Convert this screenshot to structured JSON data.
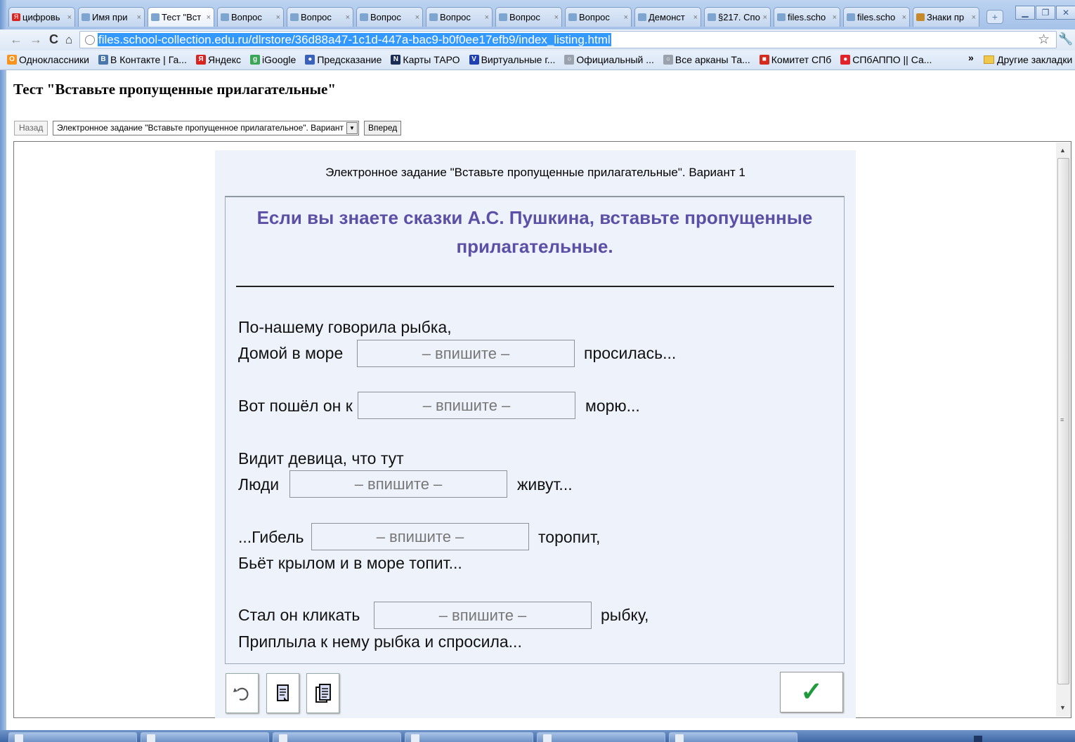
{
  "browser": {
    "tabs": [
      {
        "label": "цифровь",
        "icon": "yandex-icon"
      },
      {
        "label": "Имя при",
        "icon": "school-collection-icon"
      },
      {
        "label": "Тест \"Вст",
        "icon": "school-collection-icon",
        "active": true
      },
      {
        "label": "Вопрос",
        "icon": "school-collection-icon"
      },
      {
        "label": "Вопрос",
        "icon": "school-collection-icon"
      },
      {
        "label": "Вопрос",
        "icon": "school-collection-icon"
      },
      {
        "label": "Вопрос",
        "icon": "school-collection-icon"
      },
      {
        "label": "Вопрос",
        "icon": "school-collection-icon"
      },
      {
        "label": "Вопрос",
        "icon": "school-collection-icon"
      },
      {
        "label": "Демонст",
        "icon": "school-collection-icon"
      },
      {
        "label": "§217. Спо",
        "icon": "school-collection-icon"
      },
      {
        "label": "files.scho",
        "icon": "school-collection-icon"
      },
      {
        "label": "files.scho",
        "icon": "school-collection-icon"
      },
      {
        "label": "Знаки пр",
        "icon": "page-icon"
      }
    ],
    "url": "files.school-collection.edu.ru/dlrstore/36d88a47-1c1d-447a-bac9-b0f0ee17efb9/index_listing.html",
    "bookmarks": [
      {
        "label": "Одноклассники",
        "icon": "odnoklassniki-icon",
        "color": "#f7931e",
        "glyph": "О"
      },
      {
        "label": "В Контакте | Га...",
        "icon": "vkontakte-icon",
        "color": "#4a76a8",
        "glyph": "В"
      },
      {
        "label": "Яндекс",
        "icon": "yandex-icon",
        "color": "#d8231f",
        "glyph": "Я"
      },
      {
        "label": "iGoogle",
        "icon": "igoogle-icon",
        "color": "#3aa657",
        "glyph": "g"
      },
      {
        "label": "Предсказание",
        "icon": "globe-icon",
        "color": "#3a62b8",
        "glyph": "●"
      },
      {
        "label": "Карты ТАРО",
        "icon": "n-icon",
        "color": "#1b2c55",
        "glyph": "N"
      },
      {
        "label": "Виртуальные г...",
        "icon": "v-icon",
        "color": "#2140b0",
        "glyph": "V"
      },
      {
        "label": "Официальный ...",
        "icon": "page-icon",
        "color": "#9aa3ad",
        "glyph": "○"
      },
      {
        "label": "Все арканы Та...",
        "icon": "page-icon",
        "color": "#9aa3ad",
        "glyph": "○"
      },
      {
        "label": "Комитет СПб",
        "icon": "flag-icon",
        "color": "#d52b1e",
        "glyph": "■"
      },
      {
        "label": "СПбАППО || Са...",
        "icon": "dot-icon",
        "color": "#e0242a",
        "glyph": "●"
      }
    ],
    "bookmarks_more": "»",
    "other_bookmarks": "Другие закладки"
  },
  "page": {
    "title": "Тест \"Вставьте пропущенные прилагательные\"",
    "back_label": "Назад",
    "variant_select": "Электронное задание \"Вставьте пропущенное прилагательное\". Вариант 1",
    "forward_label": "Вперед"
  },
  "task": {
    "header": "Электронное задание \"Вставьте пропущенные прилагательные\". Вариант 1",
    "question": "Если вы знаете сказки А.С. Пушкина, вставьте пропущенные прилагательные.",
    "placeholder": "– впишите –",
    "items": [
      {
        "pre_line": "По-нашему говорила рыбка,",
        "before": "Домой в море",
        "after": "просилась..."
      },
      {
        "before": "Вот пошёл он к",
        "after": "морю..."
      },
      {
        "pre_line": "Видит девица, что тут",
        "before": "Люди",
        "after": "живут..."
      },
      {
        "before": "...Гибель",
        "after": "торопит,",
        "post_line": "Бьёт крылом и в море топит..."
      },
      {
        "before": "Стал он кликать",
        "after": "рыбку,",
        "post_line": "Приплыла к нему рыбка и спросила..."
      }
    ],
    "tools": [
      {
        "name": "undo-icon"
      },
      {
        "name": "page-list-icon"
      },
      {
        "name": "pages-icon"
      }
    ],
    "check_icon": "checkmark-icon",
    "accent_color": "#5b4fa6",
    "check_color": "#1f9a3a"
  }
}
